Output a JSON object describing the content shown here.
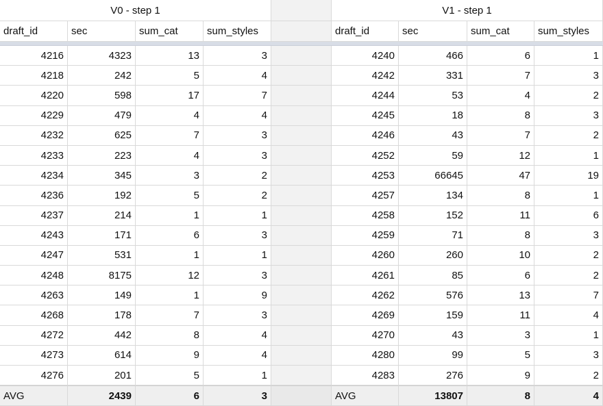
{
  "left": {
    "title": "V0 - step 1",
    "columns": [
      "draft_id",
      "sec",
      "sum_cat",
      "sum_styles"
    ],
    "rows": [
      [
        "4216",
        "4323",
        "13",
        "3"
      ],
      [
        "4218",
        "242",
        "5",
        "4"
      ],
      [
        "4220",
        "598",
        "17",
        "7"
      ],
      [
        "4229",
        "479",
        "4",
        "4"
      ],
      [
        "4232",
        "625",
        "7",
        "3"
      ],
      [
        "4233",
        "223",
        "4",
        "3"
      ],
      [
        "4234",
        "345",
        "3",
        "2"
      ],
      [
        "4236",
        "192",
        "5",
        "2"
      ],
      [
        "4237",
        "214",
        "1",
        "1"
      ],
      [
        "4243",
        "171",
        "6",
        "3"
      ],
      [
        "4247",
        "531",
        "1",
        "1"
      ],
      [
        "4248",
        "8175",
        "12",
        "3"
      ],
      [
        "4263",
        "149",
        "1",
        "9"
      ],
      [
        "4268",
        "178",
        "7",
        "3"
      ],
      [
        "4272",
        "442",
        "8",
        "4"
      ],
      [
        "4273",
        "614",
        "9",
        "4"
      ],
      [
        "4276",
        "201",
        "5",
        "1"
      ]
    ],
    "footer": [
      "AVG",
      "2439",
      "6",
      "3"
    ]
  },
  "right": {
    "title": "V1 - step 1",
    "columns": [
      "draft_id",
      "sec",
      "sum_cat",
      "sum_styles"
    ],
    "rows": [
      [
        "4240",
        "466",
        "6",
        "1"
      ],
      [
        "4242",
        "331",
        "7",
        "3"
      ],
      [
        "4244",
        "53",
        "4",
        "2"
      ],
      [
        "4245",
        "18",
        "8",
        "3"
      ],
      [
        "4246",
        "43",
        "7",
        "2"
      ],
      [
        "4252",
        "59",
        "12",
        "1"
      ],
      [
        "4253",
        "66645",
        "47",
        "19"
      ],
      [
        "4257",
        "134",
        "8",
        "1"
      ],
      [
        "4258",
        "152",
        "11",
        "6"
      ],
      [
        "4259",
        "71",
        "8",
        "3"
      ],
      [
        "4260",
        "260",
        "10",
        "2"
      ],
      [
        "4261",
        "85",
        "6",
        "2"
      ],
      [
        "4262",
        "576",
        "13",
        "7"
      ],
      [
        "4269",
        "159",
        "11",
        "4"
      ],
      [
        "4270",
        "43",
        "3",
        "1"
      ],
      [
        "4280",
        "99",
        "5",
        "3"
      ],
      [
        "4283",
        "276",
        "9",
        "2"
      ]
    ],
    "footer": [
      "AVG",
      "13807",
      "8",
      "4"
    ]
  }
}
